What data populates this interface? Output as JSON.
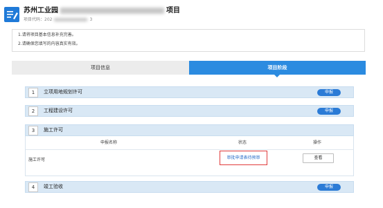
{
  "header": {
    "title_prefix": "苏州工业园",
    "title_suffix": "项目",
    "subtitle_prefix": "项目代码：",
    "subtitle_visible_a": "202",
    "subtitle_visible_b": "3",
    "icon": "edit-document-icon"
  },
  "notice": {
    "lines": [
      "1.请将项目基本信息补充完善。",
      "2.请确保您填写的内容真实有效。"
    ]
  },
  "tabs": [
    {
      "label": "项目信息",
      "active": false
    },
    {
      "label": "项目阶段",
      "active": true
    }
  ],
  "stages": [
    {
      "num": "1",
      "name": "立项用地规划许可",
      "button": "申报"
    },
    {
      "num": "2",
      "name": "工程建设许可",
      "button": "申报"
    },
    {
      "num": "3",
      "name": "施工许可",
      "button": ""
    },
    {
      "num": "4",
      "name": "竣工验收",
      "button": "申报"
    }
  ],
  "detail": {
    "headers": [
      "申报名称",
      "状态",
      "操作"
    ],
    "rows": [
      {
        "name": "施工许可",
        "status": "审批申请表待预审",
        "action": "查看"
      }
    ]
  },
  "colors": {
    "accent": "#2b8be0",
    "stage_bar": "#d9e8f5",
    "status_link": "#2a6fc9",
    "highlight_border": "#e03a3a"
  }
}
